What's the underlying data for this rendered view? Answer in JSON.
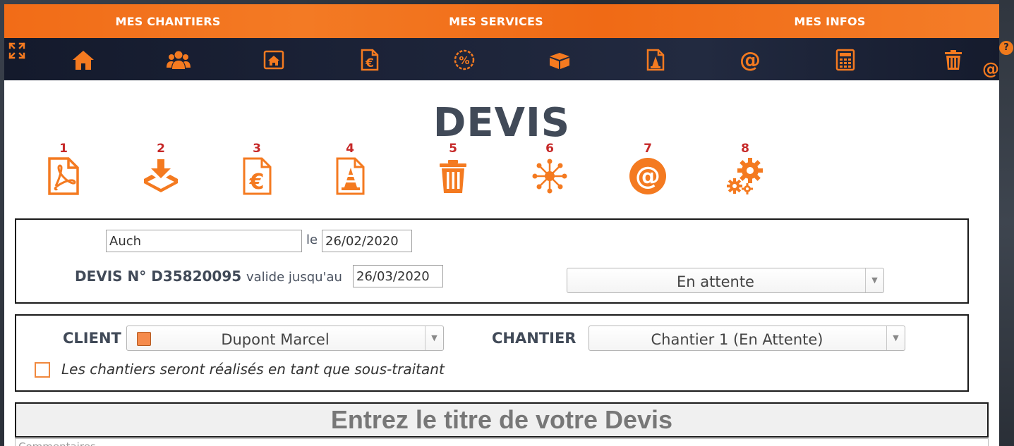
{
  "colors": {
    "accent": "#f26c17",
    "dark_bar": "#1c2338",
    "action_numbers": "#c62828",
    "title_text": "#414a58"
  },
  "topnav": {
    "items": [
      {
        "label": "MES CHANTIERS"
      },
      {
        "label": "MES SERVICES"
      },
      {
        "label": "MES INFOS"
      }
    ]
  },
  "iconbar": {
    "icons": [
      "expand-icon",
      "home-icon",
      "clients-icon",
      "house-file-icon",
      "invoice-euro-icon",
      "discount-icon",
      "package-icon",
      "construction-file-icon",
      "email-icon",
      "calculator-icon",
      "trash-icon"
    ],
    "help_label": "?",
    "at_label": "@"
  },
  "page": {
    "title": "DEVIS"
  },
  "actions": [
    {
      "num": "1",
      "icon": "pdf-file-icon"
    },
    {
      "num": "2",
      "icon": "download-tray-icon"
    },
    {
      "num": "3",
      "icon": "invoice-euro-icon"
    },
    {
      "num": "4",
      "icon": "construction-file-icon"
    },
    {
      "num": "5",
      "icon": "trash-icon"
    },
    {
      "num": "6",
      "icon": "network-icon"
    },
    {
      "num": "7",
      "icon": "email-icon"
    },
    {
      "num": "8",
      "icon": "settings-gears-icon"
    }
  ],
  "devis_info": {
    "city_value": "Auch",
    "le_label": "le",
    "date_value": "26/02/2020",
    "number_label": "DEVIS N° D35820095",
    "valid_label": "valide jusqu'au",
    "valid_date_value": "26/03/2020",
    "status_selected": "En attente",
    "arrow": "▼"
  },
  "client_box": {
    "client_label": "CLIENT",
    "client_selected": "Dupont Marcel",
    "chantier_label": "CHANTIER",
    "chantier_selected": "Chantier 1 (En Attente)",
    "subcontract_label": "Les chantiers seront réalisés en tant que sous-traitant",
    "subcontract_checked": false
  },
  "title_input": {
    "placeholder": "Entrez le titre de votre Devis"
  },
  "comment": {
    "placeholder": "Commentaires"
  }
}
